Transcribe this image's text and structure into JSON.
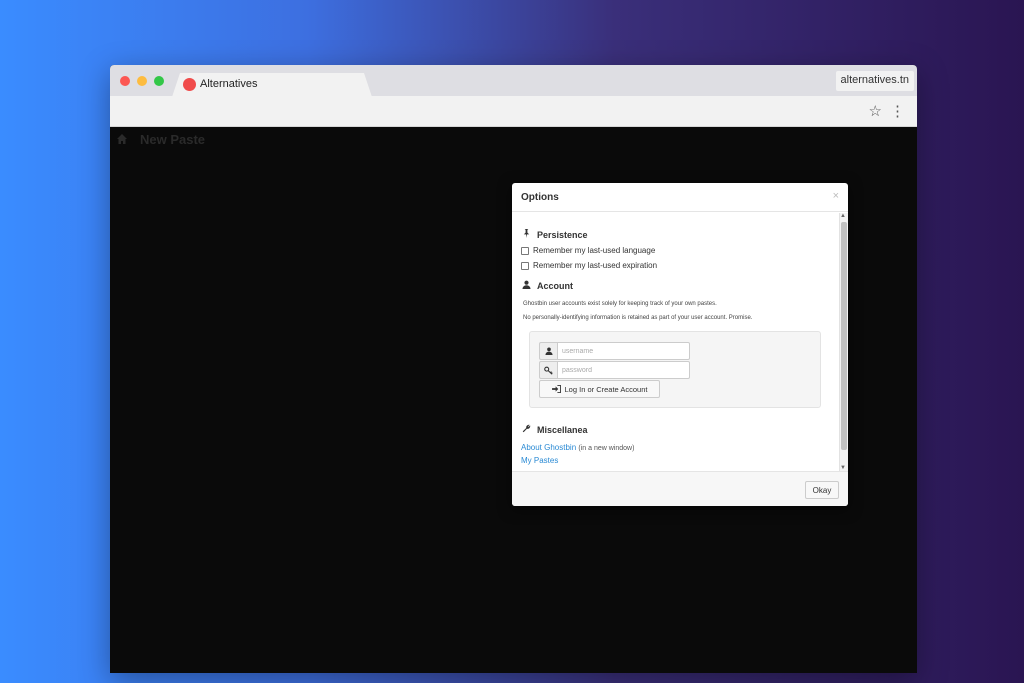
{
  "browser": {
    "tab_title": "Alternatives",
    "url": "alternatives.tn",
    "star_icon": "star-icon",
    "menu_icon": "kebab-menu-icon"
  },
  "page": {
    "title": "New Paste"
  },
  "modal": {
    "title": "Options",
    "close_glyph": "×",
    "persistence": {
      "heading": "Persistence",
      "remember_language": "Remember my last-used language",
      "remember_expiration": "Remember my last-used expiration"
    },
    "account": {
      "heading": "Account",
      "info_line1": "Ghostbin user accounts exist solely for keeping track of your own pastes.",
      "info_line2": "No personally-identifying information is retained as part of your user account. Promise.",
      "username_placeholder": "username",
      "password_placeholder": "password",
      "login_button": "Log In or Create Account"
    },
    "miscellanea": {
      "heading": "Miscellanea",
      "about_link": "About Ghostbin",
      "about_note": "(in a new window)",
      "my_pastes_link": "My Pastes"
    },
    "okay_button": "Okay"
  },
  "colors": {
    "link": "#2a8ad4",
    "favicon": "#f04b4b",
    "page_bg": "#0a0a0a"
  }
}
